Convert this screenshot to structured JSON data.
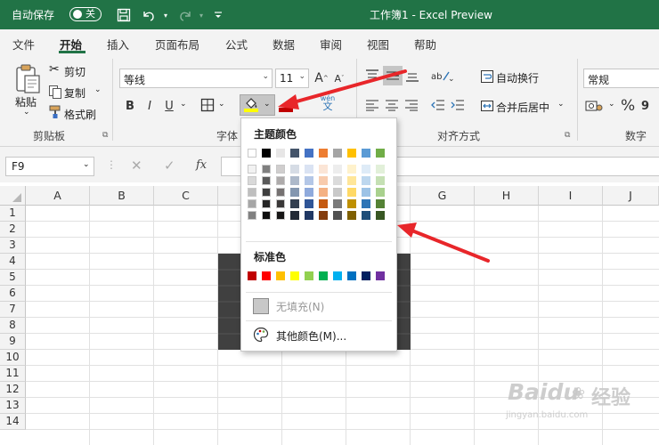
{
  "titlebar": {
    "autosave_label": "自动保存",
    "autosave_state": "关",
    "title": "工作簿1  -  Excel Preview"
  },
  "menu": [
    "文件",
    "开始",
    "插入",
    "页面布局",
    "公式",
    "数据",
    "审阅",
    "视图",
    "帮助"
  ],
  "ribbon": {
    "paste": "粘贴",
    "cut": "剪切",
    "copy": "复制",
    "format_painter": "格式刷",
    "clipboard_group": "剪贴板",
    "font_name": "等线",
    "font_size": "11",
    "font_grow": "A",
    "font_shrink": "A",
    "bold": "B",
    "italic": "I",
    "underline": "U",
    "wen_top": "wén",
    "wen_bottom": "文",
    "font_group": "字体",
    "wrap_text": "自动换行",
    "merge_center": "合并后居中",
    "alignment_group": "对齐方式",
    "number_format": "常规",
    "percent": "%",
    "number_group": "数字"
  },
  "formula_bar": {
    "name_box": "F9",
    "fx": "fx"
  },
  "columns": [
    "A",
    "B",
    "C",
    "D",
    "E",
    "F",
    "G",
    "H",
    "I",
    "J"
  ],
  "rows": [
    "1",
    "2",
    "3",
    "4",
    "5",
    "6",
    "7",
    "8",
    "9",
    "10",
    "11",
    "12",
    "13",
    "14"
  ],
  "color_panel": {
    "theme_heading": "主题颜色",
    "standard_heading": "标准色",
    "no_fill": "无填充(N)",
    "more_colors": "其他颜色(M)...",
    "theme_colors": [
      [
        "#ffffff",
        "#f2f2f2",
        "#d9d9d9",
        "#bfbfbf",
        "#a6a6a6",
        "#808080"
      ],
      [
        "#000000",
        "#7f7f7f",
        "#595959",
        "#3f3f3f",
        "#262626",
        "#0d0d0d"
      ],
      [
        "#e7e6e6",
        "#d0cece",
        "#aeabab",
        "#757171",
        "#3a3838",
        "#171616"
      ],
      [
        "#44546a",
        "#d6dce5",
        "#adb9ca",
        "#8497b0",
        "#333f50",
        "#222a35"
      ],
      [
        "#4472c4",
        "#dae3f3",
        "#b4c7e7",
        "#8faadc",
        "#2f5597",
        "#203864"
      ],
      [
        "#ed7d31",
        "#fbe5d6",
        "#f8cbad",
        "#f4b183",
        "#c55a11",
        "#843c0c"
      ],
      [
        "#a5a5a5",
        "#ededed",
        "#dbdbdb",
        "#c9c9c9",
        "#7b7b7b",
        "#525252"
      ],
      [
        "#ffc000",
        "#fff2cc",
        "#ffe699",
        "#ffd966",
        "#bf9000",
        "#7f6000"
      ],
      [
        "#5b9bd5",
        "#deebf7",
        "#bdd7ee",
        "#9dc3e6",
        "#2e75b6",
        "#1f4e79"
      ],
      [
        "#70ad47",
        "#e2f0d9",
        "#c5e0b4",
        "#a9d18e",
        "#548235",
        "#385723"
      ]
    ],
    "standard_colors": [
      "#c00000",
      "#ff0000",
      "#ffc000",
      "#ffff00",
      "#92d050",
      "#00b050",
      "#00b0f0",
      "#0070c0",
      "#002060",
      "#7030a0"
    ]
  },
  "colors": {
    "excel_green": "#217346",
    "fill_yellow": "#ffff00",
    "font_red": "#c00000",
    "dark_cells": "#404040",
    "arrow_red": "#e8262a"
  },
  "watermark": {
    "brand": "Baidu",
    "brand_cn": "经验",
    "url": "jingyan.baidu.com"
  }
}
